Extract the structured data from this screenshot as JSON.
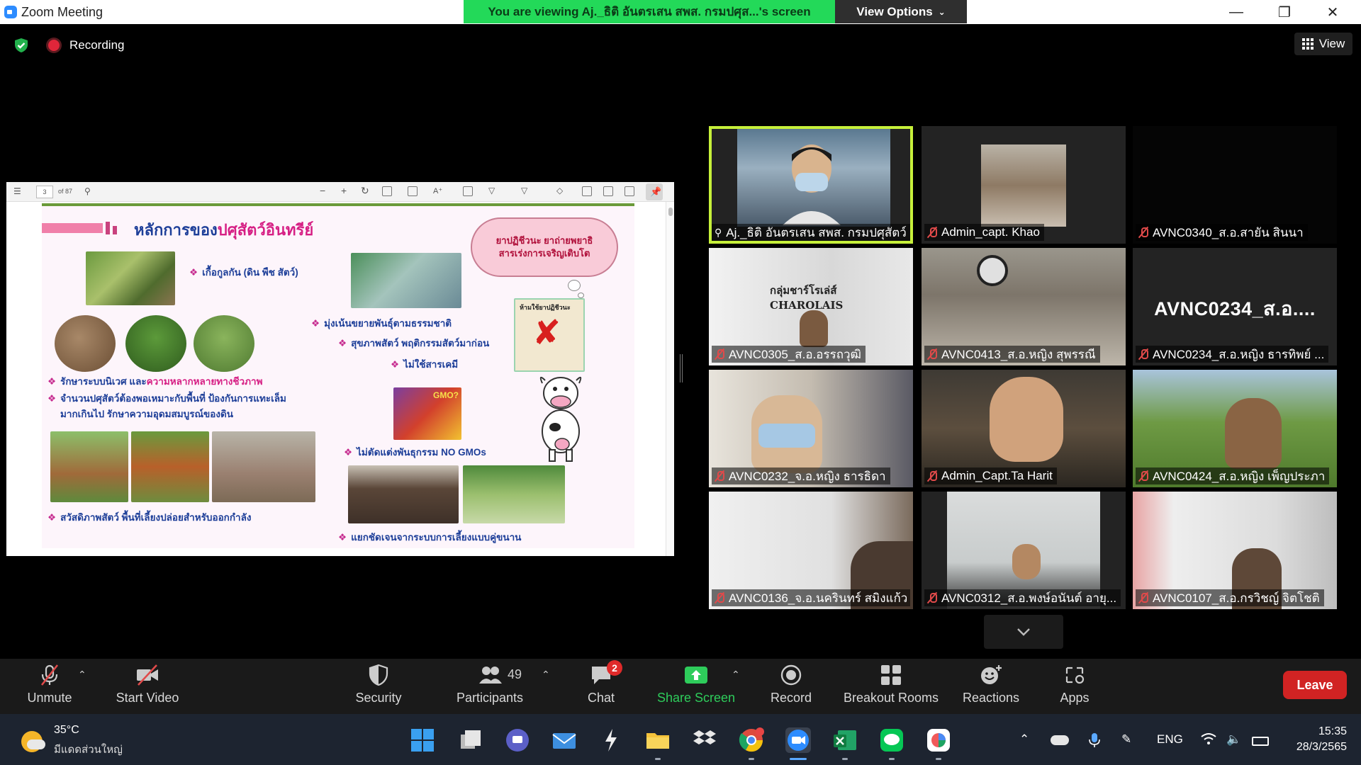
{
  "window": {
    "title": "Zoom Meeting",
    "viewing_banner": "You are viewing Aj._ธิติ อันตรเสน สพส. กรมปศุส...'s screen",
    "view_options": "View Options"
  },
  "meeting_bar": {
    "recording_label": "Recording",
    "view_label": "View"
  },
  "pdf_viewer": {
    "page_number": "3",
    "page_total": "of 87"
  },
  "slide": {
    "title_prefix": "หลักการของ",
    "title_accent": "ปศุสัตว์อินทรีย์",
    "cloud_line1": "ยาปฏิชีวนะ ยาถ่ายพยาธิ",
    "cloud_line2": "สารเร่งการเจริญเติบโต",
    "bullets": [
      "เกื้อกูลกัน (ดิน พืช สัตว์)",
      "มุ่งเน้นขยายพันธุ์ตามธรรมชาติ",
      "สุขภาพสัตว์ พฤติกรรมสัตว์มาก่อน",
      "ไม่ใช้สารเคมี",
      "ไม่ตัดแต่งพันธุกรรม  NO GMOs",
      "สวัสดิภาพสัตว์ พื้นที่เลี้ยงปล่อยสำหรับออกกำลัง",
      "แยกชัดเจนจากระบบการเลี้ยงแบบคู่ขนาน"
    ],
    "biodiversity_prefix": "รักษาระบบนิเวศ และ",
    "biodiversity_accent": "ความหลากหลายทางชีวภาพ",
    "stocking_line1": "จำนวนปศุสัตว์ต้องพอเหมาะกับพื้นที่ ป้องกันการแทะเล็ม",
    "stocking_line2": "มากเกินไป รักษาความอุดมสมบูรณ์ของดิน",
    "sign_label": "ห้ามใช้ยาปฏิชีวนะ",
    "gmo_label": "GMO?"
  },
  "participants_tiles": [
    {
      "name": "Aj._ธิติ อันตรเสน สพส. กรมปศุสัตว์",
      "muted": false,
      "active": true
    },
    {
      "name": "Admin_capt. Khao",
      "muted": true
    },
    {
      "name": "AVNC0340_ส.อ.สายัน สินนา",
      "muted": true
    },
    {
      "name": "AVNC0305_ส.อ.อรรถวุฒิ",
      "muted": true,
      "overlay": "กลุ่มชาร์โรเล่ส์ CHAROLAIS"
    },
    {
      "name": "AVNC0413_ส.อ.หญิง สุพรรณี",
      "muted": true
    },
    {
      "name": "AVNC0234_ส.อ.หญิง ธารทิพย์ ...",
      "muted": true,
      "big_name": "AVNC0234_ส.อ...."
    },
    {
      "name": "AVNC0232_จ.อ.หญิง ธารธิดา",
      "muted": true
    },
    {
      "name": "Admin_Capt.Ta Harit",
      "muted": true
    },
    {
      "name": "AVNC0424_ส.อ.หญิง เพ็ญประภา",
      "muted": true
    },
    {
      "name": "AVNC0136_จ.อ.นครินทร์ สมิงแก้ว",
      "muted": true
    },
    {
      "name": "AVNC0312_ส.อ.พงษ์อนันต์ อายุ...",
      "muted": true
    },
    {
      "name": "AVNC0107_ส.อ.กรวิชญ์ จิตโชติ",
      "muted": true
    }
  ],
  "toolbar": {
    "unmute": "Unmute",
    "start_video": "Start Video",
    "security": "Security",
    "participants": "Participants",
    "participants_count": "49",
    "chat": "Chat",
    "chat_badge": "2",
    "share_screen": "Share Screen",
    "record": "Record",
    "breakout_rooms": "Breakout Rooms",
    "reactions": "Reactions",
    "apps": "Apps",
    "leave": "Leave"
  },
  "taskbar": {
    "temperature": "35°C",
    "weather_desc": "มีแดดส่วนใหญ่",
    "language": "ENG",
    "time": "15:35",
    "date": "28/3/2565"
  },
  "colors": {
    "banner_green": "#23d959",
    "active_speaker": "#c6f03a",
    "share_green": "#2ecc5b",
    "leave_red": "#d12323",
    "slide_blue": "#1e3f99",
    "slide_pink": "#d61f84"
  }
}
